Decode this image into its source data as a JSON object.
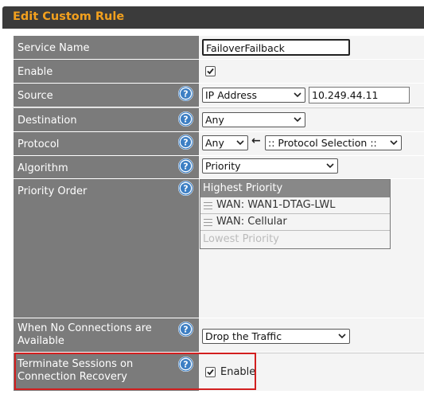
{
  "title": "Edit Custom Rule",
  "rows": {
    "service_name": {
      "label": "Service Name",
      "value": "FailoverFailback"
    },
    "enable": {
      "label": "Enable",
      "checked": true
    },
    "source": {
      "label": "Source",
      "type": "IP Address",
      "ip": "10.249.44.11"
    },
    "destination": {
      "label": "Destination",
      "value": "Any"
    },
    "protocol": {
      "label": "Protocol",
      "value": "Any",
      "arrow": "←",
      "selection": ":: Protocol Selection ::"
    },
    "algorithm": {
      "label": "Algorithm",
      "value": "Priority"
    },
    "priority_order": {
      "label": "Priority Order",
      "header": "Highest Priority",
      "items": [
        "WAN: WAN1-DTAG-LWL",
        "WAN: Cellular"
      ],
      "footer": "Lowest Priority"
    },
    "no_connections": {
      "label": "When No Connections are Available",
      "value": "Drop the Traffic"
    },
    "terminate": {
      "label": "Terminate Sessions on Connection Recovery",
      "checkbox_label": "Enable",
      "checked": true
    }
  },
  "colors": {
    "title_text": "#f2a01e",
    "label_bg": "#7b7b7b",
    "help_icon": "#3d7fc4",
    "highlight": "#d21f1f"
  }
}
